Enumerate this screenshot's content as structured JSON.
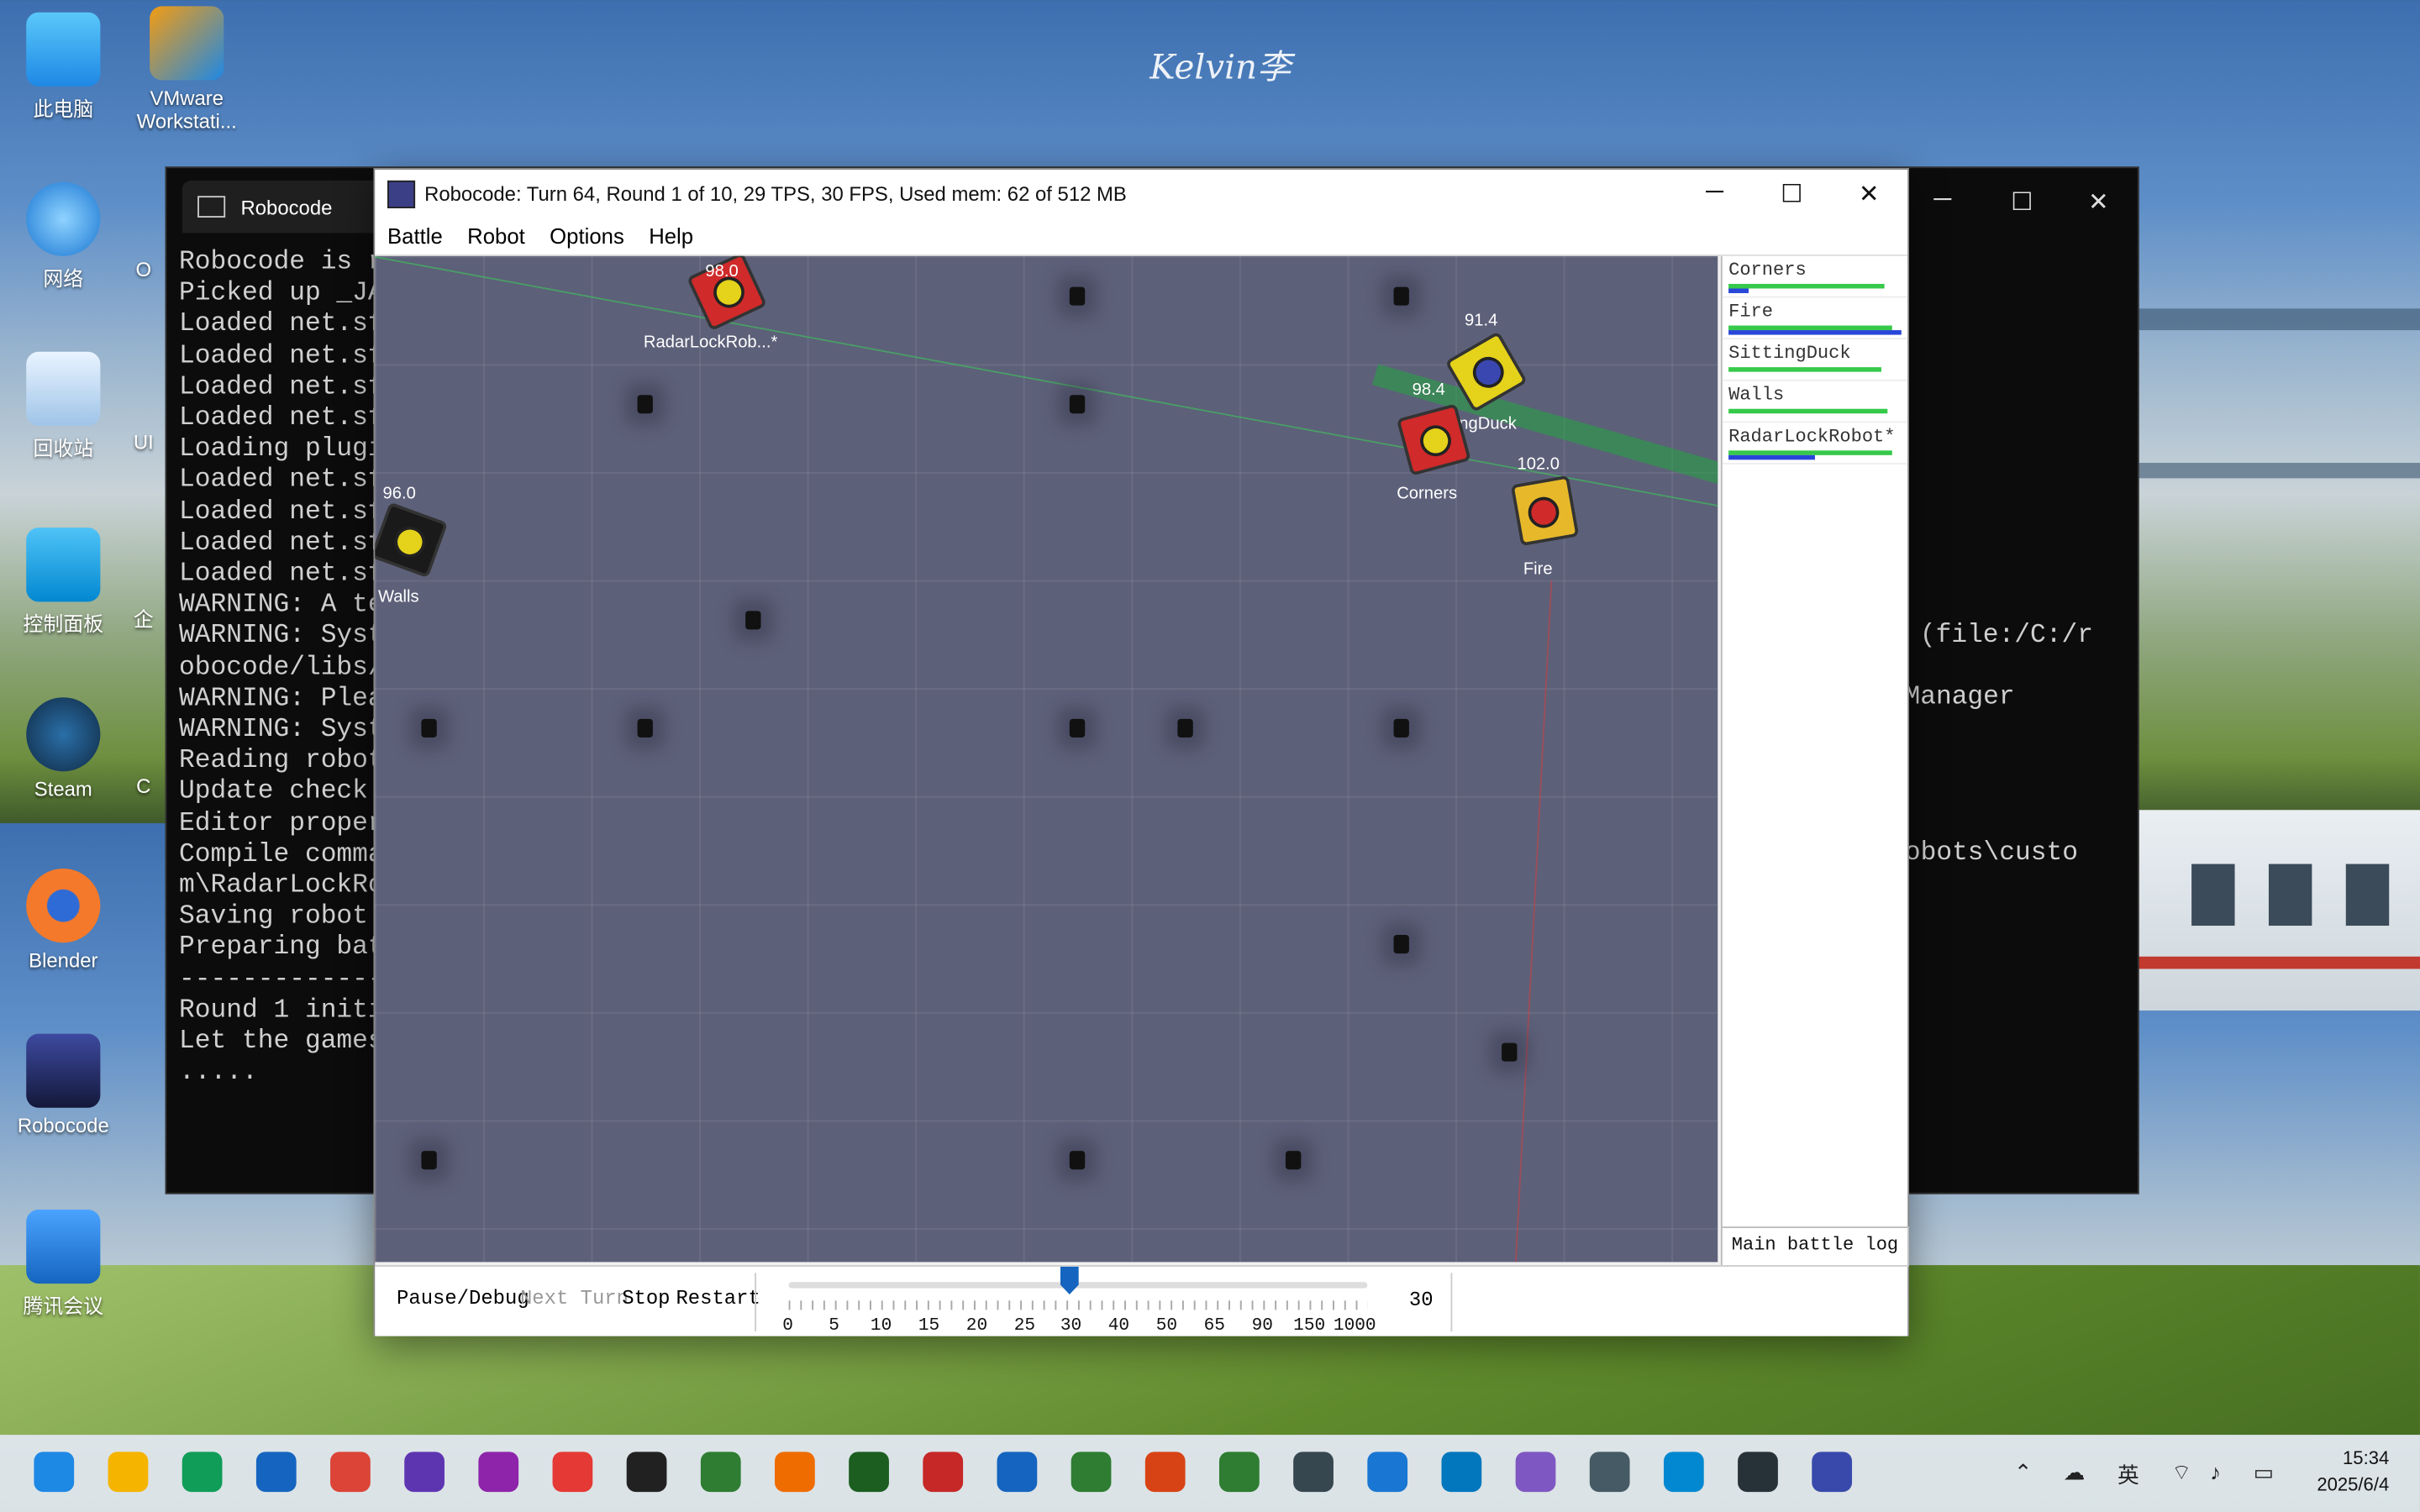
{
  "desktop": {
    "watermark": "Kelvin李",
    "icons": [
      {
        "label": "此电脑",
        "icon": "computer-icon"
      },
      {
        "label": "VMware Workstati...",
        "icon": "vmware-icon"
      },
      {
        "label": "网络",
        "icon": "network-icon"
      },
      {
        "label": "回收站",
        "icon": "recycle-bin-icon"
      },
      {
        "label": "控制面板",
        "icon": "control-panel-icon"
      },
      {
        "label": "Steam",
        "icon": "steam-icon"
      },
      {
        "label": "Blender",
        "icon": "blender-icon"
      },
      {
        "label": "Robocode",
        "icon": "robocode-icon"
      },
      {
        "label": "腾讯会议",
        "icon": "tencent-meeting-icon"
      }
    ],
    "partial_labels": [
      "O",
      "UI",
      "企",
      "C"
    ]
  },
  "terminal": {
    "tab_title": "Robocode",
    "lines": [
      "Robocode is r",
      "Picked up _JA",
      "Loaded net.sf",
      "Loaded net.sf",
      "Loaded net.sf",
      "Loaded net.sf",
      "Loading plugi",
      "Loaded net.sf",
      "Loaded net.sf",
      "Loaded net.sf",
      "Loaded net.sf",
      "WARNING: A te",
      "WARNING: Syst",
      "obocode/libs/",
      "WARNING: Plea",
      "WARNING: Syst",
      "Reading robot",
      "Update check",
      "Editor proper",
      "Compile comma",
      "m\\RadarLockRo",
      "Saving robot",
      "Preparing bat",
      "-------------",
      "Round 1 initi",
      "Let the games",
      "....."
    ],
    "right_fragments": [
      "(file:/C:/r",
      "Manager",
      "robots\\custo"
    ]
  },
  "robocode": {
    "title": "Robocode: Turn 64, Round 1 of 10, 29 TPS, 30 FPS, Used mem: 62 of 512 MB",
    "menu": [
      "Battle",
      "Robot",
      "Options",
      "Help"
    ],
    "robots_on_field": [
      {
        "name": "RadarLockRob...*",
        "energy": "98.0",
        "color": "#d02a2a"
      },
      {
        "name": "SittingDuck",
        "energy": "91.4",
        "color": "#e5d21a"
      },
      {
        "name": "Corners",
        "energy": "98.4",
        "color": "#d02a2a"
      },
      {
        "name": "Fire",
        "energy": "102.0",
        "color": "#e7b92a"
      },
      {
        "name": "Walls",
        "energy": "96.0",
        "color": "#1a1a1a"
      }
    ],
    "sidebar": [
      {
        "name": "Corners",
        "energy_fraction": 0.9,
        "score_fraction": 0.12
      },
      {
        "name": "Fire",
        "energy_fraction": 0.95,
        "score_fraction": 1.0
      },
      {
        "name": "SittingDuck",
        "energy_fraction": 0.88,
        "score_fraction": 0.0
      },
      {
        "name": "Walls",
        "energy_fraction": 0.92,
        "score_fraction": 0.0
      },
      {
        "name": "RadarLockRobot*",
        "energy_fraction": 0.95,
        "score_fraction": 0.5
      }
    ],
    "main_battle_log": "Main battle log",
    "controls": {
      "pause": "Pause/Debug",
      "next_turn": "Next Turn",
      "stop": "Stop",
      "restart": "Restart",
      "tps_value": "30",
      "tick_labels": [
        "0",
        "5",
        "10",
        "15",
        "20",
        "25",
        "30",
        "40",
        "50",
        "65",
        "90",
        "150",
        "1000"
      ]
    }
  },
  "taskbar": {
    "apps": [
      "start-icon",
      "file-explorer-icon",
      "edge-icon",
      "edge-ai-icon",
      "chrome-icon",
      "app-icon",
      "app-icon",
      "netease-music-icon",
      "qq-icon",
      "wechat-icon",
      "matlab-icon",
      "pycharm-icon",
      "intellij-icon",
      "word-icon",
      "excel-icon",
      "powerpoint-icon",
      "pycharm-icon",
      "app-icon",
      "vscode-icon",
      "app-icon",
      "app-icon",
      "app-icon",
      "app-icon",
      "terminal-icon",
      "robocode-icon"
    ],
    "ime": "英",
    "time": "15:34",
    "date": "2025/6/4"
  }
}
